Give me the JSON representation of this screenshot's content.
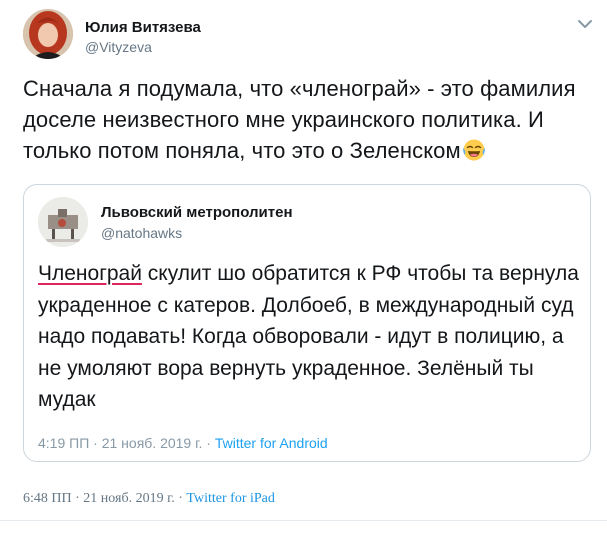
{
  "tweet": {
    "author": {
      "name": "Юлия Витязева",
      "handle": "@Vityzeva"
    },
    "text_before_emoji": "Сначала я подумала, что «членограй» - это фамилия доселе неизвестного мне украинского политика. И только потом поняла, что это о Зеленском",
    "emoji": "face-with-tears-of-joy",
    "time": "6:48 ПП",
    "separator": " · ",
    "date": "21 нояб. 2019 г.",
    "source": "Twitter for iPad"
  },
  "quoted_tweet": {
    "author": {
      "name": "Львовский метрополитен",
      "handle": "@natohawks"
    },
    "underlined_word": "Членограй",
    "text_rest": " скулит шо обратится к РФ чтобы та вернула украденное с катеров. Долбоеб, в международный суд надо подавать! Когда обворовали - идут в полицию, а не умоляют вора вернуть украденное. Зелёный ты мудак",
    "time": "4:19 ПП",
    "separator": " · ",
    "date": "21 нояб. 2019 г.",
    "source": "Twitter for Android"
  },
  "colors": {
    "link": "#1da1f2",
    "secondary_text": "#657786",
    "card_border": "#ccd6dd",
    "underline_accent": "#e0245e"
  }
}
